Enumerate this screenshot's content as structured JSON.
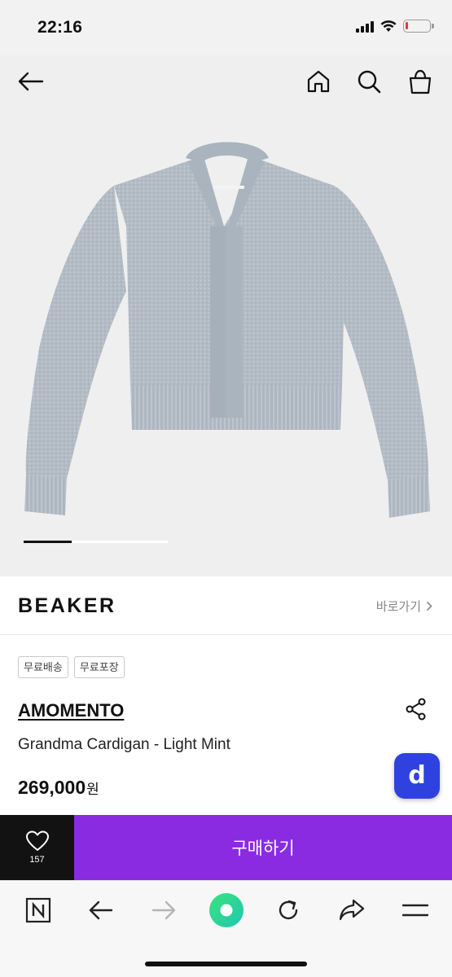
{
  "status_bar": {
    "time": "22:16",
    "battery_level": 0.12,
    "battery_color": "#e53935"
  },
  "top_nav": {
    "back_icon": "arrow-left-icon",
    "home_icon": "home-icon",
    "search_icon": "search-icon",
    "cart_icon": "shopping-bag-icon"
  },
  "gallery": {
    "current_slide": 1,
    "slide_count": 3
  },
  "brand_row": {
    "logo": "BEAKER",
    "shortcut_label": "바로가기",
    "shortcut_icon": "chevron-right-icon"
  },
  "tags": [
    "무료배송",
    "무료포장"
  ],
  "product": {
    "brand": "AMOMENTO",
    "name": "Grandma Cardigan - Light Mint",
    "price": "269,000",
    "currency": "원",
    "share_icon": "share-icon"
  },
  "chat_fab": {
    "letter": "d",
    "color": "#2f42e0"
  },
  "purchase_bar": {
    "like_icon": "heart-icon",
    "like_count": "157",
    "buy_label": "구매하기",
    "buy_color": "#8a2be2"
  },
  "browser_toolbar": {
    "items": [
      "naver-icon",
      "back-arrow-icon",
      "forward-arrow-icon",
      "green-dot-icon",
      "refresh-icon",
      "share-arrow-icon",
      "menu-icon"
    ]
  }
}
